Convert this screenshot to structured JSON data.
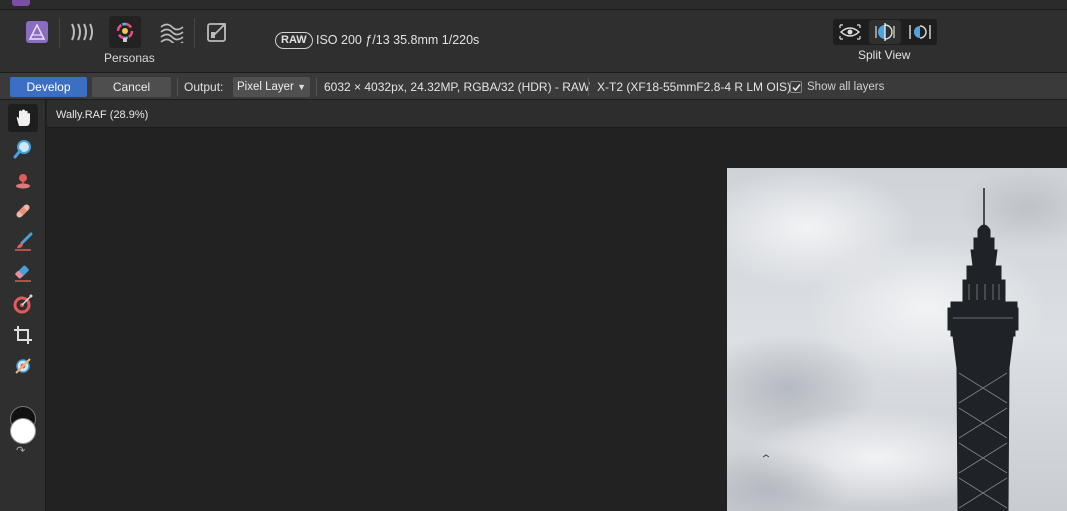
{
  "toolbar": {
    "persona_icons": [
      "photo-persona-icon",
      "liquify-persona-icon",
      "develop-persona-icon",
      "tone-mapping-persona-icon",
      "export-persona-icon"
    ],
    "personas_label": "Personas",
    "raw_badge": "RAW",
    "exif": "ISO 200 ƒ/13 35.8mm 1/220s",
    "split_view_label": "Split View",
    "view_icons": [
      "eye-icon",
      "split-view-icon",
      "mirror-view-icon"
    ]
  },
  "context_bar": {
    "develop_label": "Develop",
    "cancel_label": "Cancel",
    "output_label": "Output:",
    "output_value": "Pixel Layer",
    "image_info": "6032 × 4032px, 24.32MP, RGBA/32 (HDR) - RAW",
    "camera_info": "X-T2 (XF18-55mmF2.8-4 R LM OIS)",
    "show_all_layers_label": "Show all layers",
    "show_all_layers_checked": true
  },
  "tools": [
    "view-tool-icon",
    "zoom-tool-icon",
    "white-balance-tool-icon",
    "blemish-removal-tool-icon",
    "overlay-paint-tool-icon",
    "overlay-erase-tool-icon",
    "overlay-gradient-tool-icon",
    "crop-tool-icon",
    "red-eye-tool-icon"
  ],
  "colors": {
    "accent": "#3c6fc4",
    "primary_color": "#ffffff",
    "secondary_color": "#111111"
  },
  "document": {
    "title": "Wally.RAF (28.9%)"
  }
}
